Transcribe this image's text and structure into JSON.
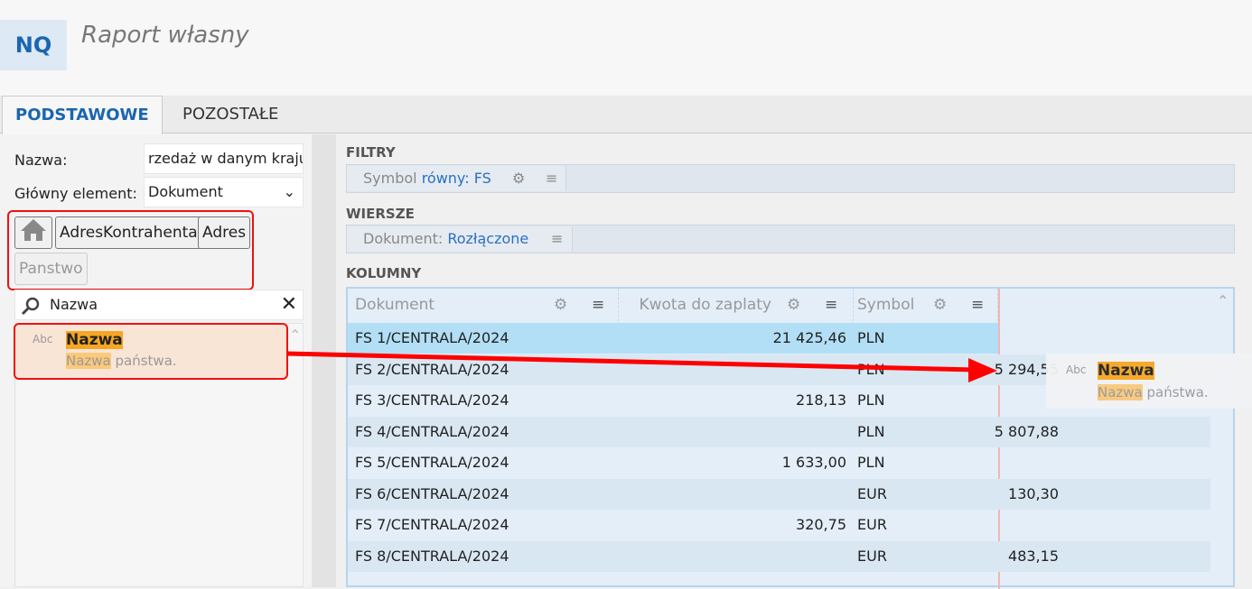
{
  "header": {
    "logo": "NQ",
    "title": "Raport własny"
  },
  "tabs": [
    {
      "label": "PODSTAWOWE",
      "active": true
    },
    {
      "label": "POZOSTAŁE",
      "active": false
    }
  ],
  "left": {
    "name_label": "Nazwa:",
    "name_value": "rzedaż w danym kraju",
    "main_label": "Główny element:",
    "main_value": "Dokument",
    "breadcrumbs": [
      "AdresKontrahenta",
      "Adres",
      "Panstwo"
    ],
    "search_value": "Nazwa",
    "result": {
      "type": "Abc",
      "title": "Nazwa",
      "desc_hl": "Nazwa",
      "desc_rest": " państwa."
    }
  },
  "filters": {
    "title": "FILTRY",
    "chip_label": "Symbol ",
    "chip_value": "równy: FS"
  },
  "rows_section": {
    "title": "WIERSZE",
    "chip_label": "Dokument: ",
    "chip_value": "Rozłączone"
  },
  "columns": {
    "title": "KOLUMNY",
    "headers": [
      "Dokument",
      "Kwota do zaplaty",
      "Symbol"
    ],
    "rows": [
      [
        "FS 1/CENTRALA/2024",
        "21 425,46",
        "PLN"
      ],
      [
        "FS 2/CENTRALA/2024",
        "5 294,55",
        "PLN"
      ],
      [
        "FS 3/CENTRALA/2024",
        "218,13",
        "PLN"
      ],
      [
        "FS 4/CENTRALA/2024",
        "5 807,88",
        "PLN"
      ],
      [
        "FS 5/CENTRALA/2024",
        "1 633,00",
        "PLN"
      ],
      [
        "FS 6/CENTRALA/2024",
        "130,30",
        "EUR"
      ],
      [
        "FS 7/CENTRALA/2024",
        "320,75",
        "EUR"
      ],
      [
        "FS 8/CENTRALA/2024",
        "483,15",
        "EUR"
      ]
    ]
  },
  "drag": {
    "type": "Abc",
    "title": "Nazwa",
    "desc_hl": "Nazwa",
    "desc_rest": " państwa."
  },
  "colors": {
    "accent": "#1a66b0",
    "highlight": "#f7a623",
    "annotation": "#ff0000"
  }
}
